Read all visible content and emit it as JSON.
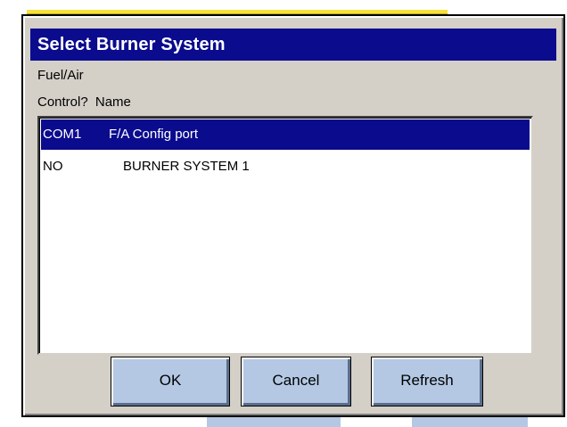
{
  "dialog": {
    "title": "Select Burner System",
    "column_header_line1": "Fuel/Air",
    "column_header_col1": "Control?",
    "column_header_col2": "Name"
  },
  "list": {
    "rows": [
      {
        "control": "COM1",
        "name": "F/A Config port",
        "selected": true
      },
      {
        "control": "NO",
        "name": "BURNER SYSTEM 1",
        "selected": false
      }
    ]
  },
  "buttons": {
    "ok_label": "OK",
    "cancel_label": "Cancel",
    "refresh_label": "Refresh"
  },
  "colors": {
    "titlebar": "#0b0b8e",
    "selection": "#0b0b8e",
    "dialog_bg": "#d4d0c8",
    "button_bg": "#b4c8e4",
    "background_strip": "#f5e13a"
  }
}
